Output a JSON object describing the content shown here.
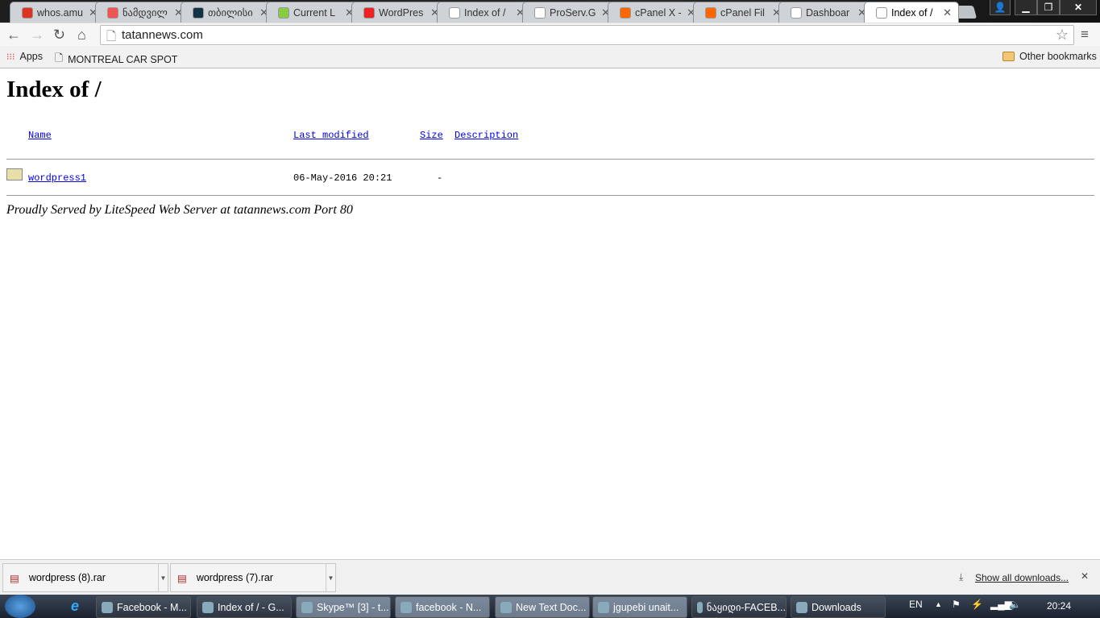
{
  "tabs": [
    {
      "label": "whos.amu",
      "color": "#d32"
    },
    {
      "label": "ნამდვილ",
      "color": "#e55"
    },
    {
      "label": "თბილისი",
      "color": "#134"
    },
    {
      "label": "Current L",
      "color": "#8c4"
    },
    {
      "label": "WordPres",
      "color": "#e22"
    },
    {
      "label": "Index of /",
      "color": "#fff"
    },
    {
      "label": "ProServ.G",
      "color": "#fff"
    },
    {
      "label": "cPanel X -",
      "color": "#f60"
    },
    {
      "label": "cPanel Fil",
      "color": "#f60"
    },
    {
      "label": "Dashboar",
      "color": "#fff"
    },
    {
      "label": "Index of /",
      "color": "#fff"
    }
  ],
  "address": "tatannews.com",
  "bookmarks": {
    "apps": "Apps",
    "item1": "MONTREAL CAR SPOT",
    "other": "Other bookmarks"
  },
  "page": {
    "title": "Index of /",
    "headers": {
      "name": "Name",
      "modified": "Last modified",
      "size": "Size",
      "description": "Description"
    },
    "rows": [
      {
        "name": "wordpress1",
        "modified": "06-May-2016 20:21",
        "size": "-"
      }
    ],
    "footer": "Proudly Served by LiteSpeed Web Server at tatannews.com Port 80"
  },
  "downloads": {
    "items": [
      "wordpress (8).rar",
      "wordpress (7).rar"
    ],
    "show_all": "Show all downloads..."
  },
  "taskbar": {
    "items": [
      "Facebook - M...",
      "Index of / - G...",
      "Skype™ [3] - t...",
      "facebook - N...",
      "New Text Doc...",
      "jgupebi unait...",
      "ნაყიდი-FACEB...",
      "Downloads"
    ],
    "lang": "EN",
    "clock": "20:24"
  }
}
